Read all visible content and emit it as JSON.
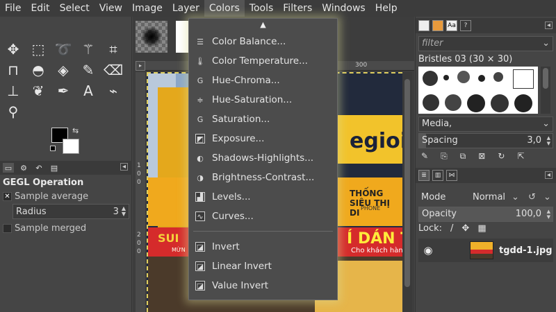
{
  "menubar": {
    "items": [
      "File",
      "Edit",
      "Select",
      "View",
      "Image",
      "Layer",
      "Colors",
      "Tools",
      "Filters",
      "Windows",
      "Help"
    ],
    "active": "Colors"
  },
  "tool_options": {
    "title": "GEGL Operation",
    "sample_average_label": "Sample average",
    "radius_label": "Radius",
    "radius_value": "3",
    "sample_merged_label": "Sample merged"
  },
  "canvas": {
    "ruler_mark": "300",
    "photo_brand": "egioi",
    "photo_orange_text": "THỐNG SIÊU THỊ DI",
    "photo_phone": "PHONE",
    "photo_red_text": "Í DÁN TRO",
    "photo_red_sub": "Cho khách hàng sỉ",
    "photo_red_left": "SUI",
    "photo_red_left2": "MỪN",
    "ruler_left": [
      "1",
      "0",
      "0",
      "2",
      "0",
      "0"
    ]
  },
  "colors_menu": {
    "items": [
      {
        "label": "Color Balance...",
        "icon": "color-balance-icon",
        "glyph": "☰"
      },
      {
        "label": "Color Temperature...",
        "icon": "thermometer-icon",
        "glyph": "🌡"
      },
      {
        "label": "Hue-Chroma...",
        "icon": "gegl-icon",
        "glyph": "G"
      },
      {
        "label": "Hue-Saturation...",
        "icon": "hue-saturation-icon",
        "glyph": "≑"
      },
      {
        "label": "Saturation...",
        "icon": "gegl-icon",
        "glyph": "G"
      },
      {
        "label": "Exposure...",
        "icon": "exposure-icon",
        "glyph": "◩"
      },
      {
        "label": "Shadows-Highlights...",
        "icon": "shadows-highlights-icon",
        "glyph": "◐"
      },
      {
        "label": "Brightness-Contrast...",
        "icon": "brightness-contrast-icon",
        "glyph": "◑"
      },
      {
        "label": "Levels...",
        "icon": "levels-icon",
        "glyph": "▟"
      },
      {
        "label": "Curves...",
        "icon": "curves-icon",
        "glyph": "∿"
      },
      {
        "label": "Invert",
        "icon": "invert-icon",
        "glyph": "◪"
      },
      {
        "label": "Linear Invert",
        "icon": "invert-icon",
        "glyph": "◪"
      },
      {
        "label": "Value Invert",
        "icon": "invert-icon",
        "glyph": "◪"
      }
    ]
  },
  "brushes": {
    "filter_placeholder": "filter",
    "current_brush": "Bristles 03 (30 × 30)",
    "category": "Media,",
    "spacing_label": "Spacing",
    "spacing_value": "3,0"
  },
  "layers": {
    "mode_label": "Mode",
    "mode_value": "Normal",
    "opacity_label": "Opacity",
    "opacity_value": "100,0",
    "lock_label": "Lock:",
    "layer_name": "tgdd-1.jpg"
  },
  "colors": {
    "menu_bg": "#4c4c4c",
    "glow": "#dcdc96",
    "photo_yellow": "#f2c32b",
    "photo_red": "#d52b2b"
  }
}
